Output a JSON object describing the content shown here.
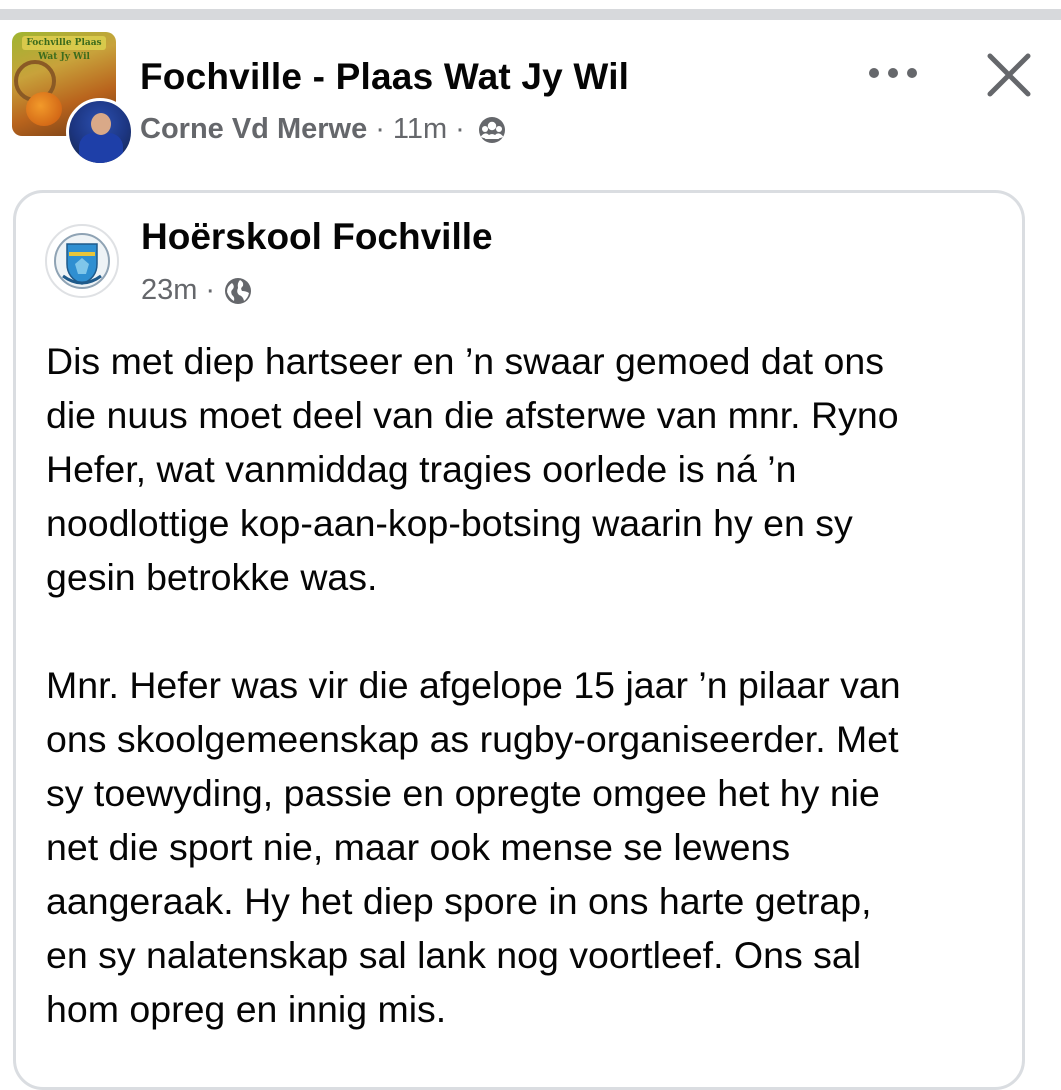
{
  "group": {
    "title": "Fochville - Plaas Wat Jy Wil",
    "cover_banner": "Fochville Plaas Wat Jy Wil",
    "author": "Corne Vd Merwe",
    "separator": "·",
    "time": "11m",
    "privacy_icon": "group-privacy-icon"
  },
  "actions": {
    "more_icon": "more-options-icon",
    "close_icon": "close-icon"
  },
  "shared_post": {
    "page_name": "Hoërskool Fochville",
    "time": "23m",
    "separator": "·",
    "audience_icon": "globe-icon",
    "paragraphs": [
      "Dis met diep hartseer en ’n swaar gemoed dat ons\ndie nuus moet deel van die afsterwe van mnr. Ryno\nHefer, wat vanmiddag tragies oorlede is ná ’n\nnoodlottige kop-aan-kop-botsing waarin hy en sy\ngesin betrokke was.",
      "Mnr. Hefer was vir die afgelope 15 jaar ’n pilaar van\nons skoolgemeenskap as rugby-organiseerder. Met\nsy toewyding, passie en opregte omgee het hy nie\nnet die sport nie, maar ook mense se lewens\naangeraak. Hy het diep spore in ons harte getrap,\nen sy nalatenskap sal lank nog voortleef. Ons sal\nhom opreg en innig mis."
    ]
  },
  "colors": {
    "text_primary": "#050505",
    "text_secondary": "#65676b",
    "card_border": "#dadde1",
    "icon_gray": "#65676b"
  }
}
